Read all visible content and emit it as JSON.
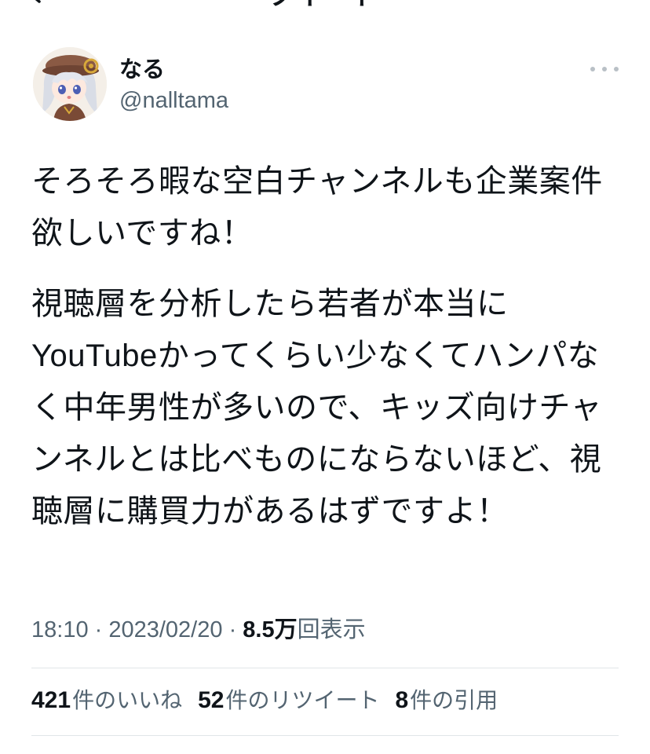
{
  "nav": {
    "title_fragment": "ツイート"
  },
  "author": {
    "display_name": "なる",
    "handle": "@nalltama"
  },
  "tweet": {
    "paragraphs": [
      "そろそろ暇な空白チャンネルも企業案件欲しいですね！",
      "視聴層を分析したら若者が本当にYouTubeかってくらい少なくてハンパなく中年男性が多いので、キッズ向けチャンネルとは比べものにならないほど、視聴層に購買力があるはずですよ！"
    ]
  },
  "meta": {
    "time": "18:10",
    "separator": " · ",
    "date": "2023/02/20",
    "views_count": "8.5万",
    "views_label": "回表示"
  },
  "stats": {
    "likes_count": "421",
    "likes_label": "件のいいね",
    "retweets_count": "52",
    "retweets_label": "件のリツイート",
    "quotes_count": "8",
    "quotes_label": "件の引用"
  },
  "colors": {
    "text_primary": "#0f1419",
    "text_secondary": "#536471",
    "divider": "#e1e5e8",
    "background": "#ffffff"
  },
  "icons": {
    "back": "chevron-left-icon",
    "more": "more-dots-icon"
  }
}
